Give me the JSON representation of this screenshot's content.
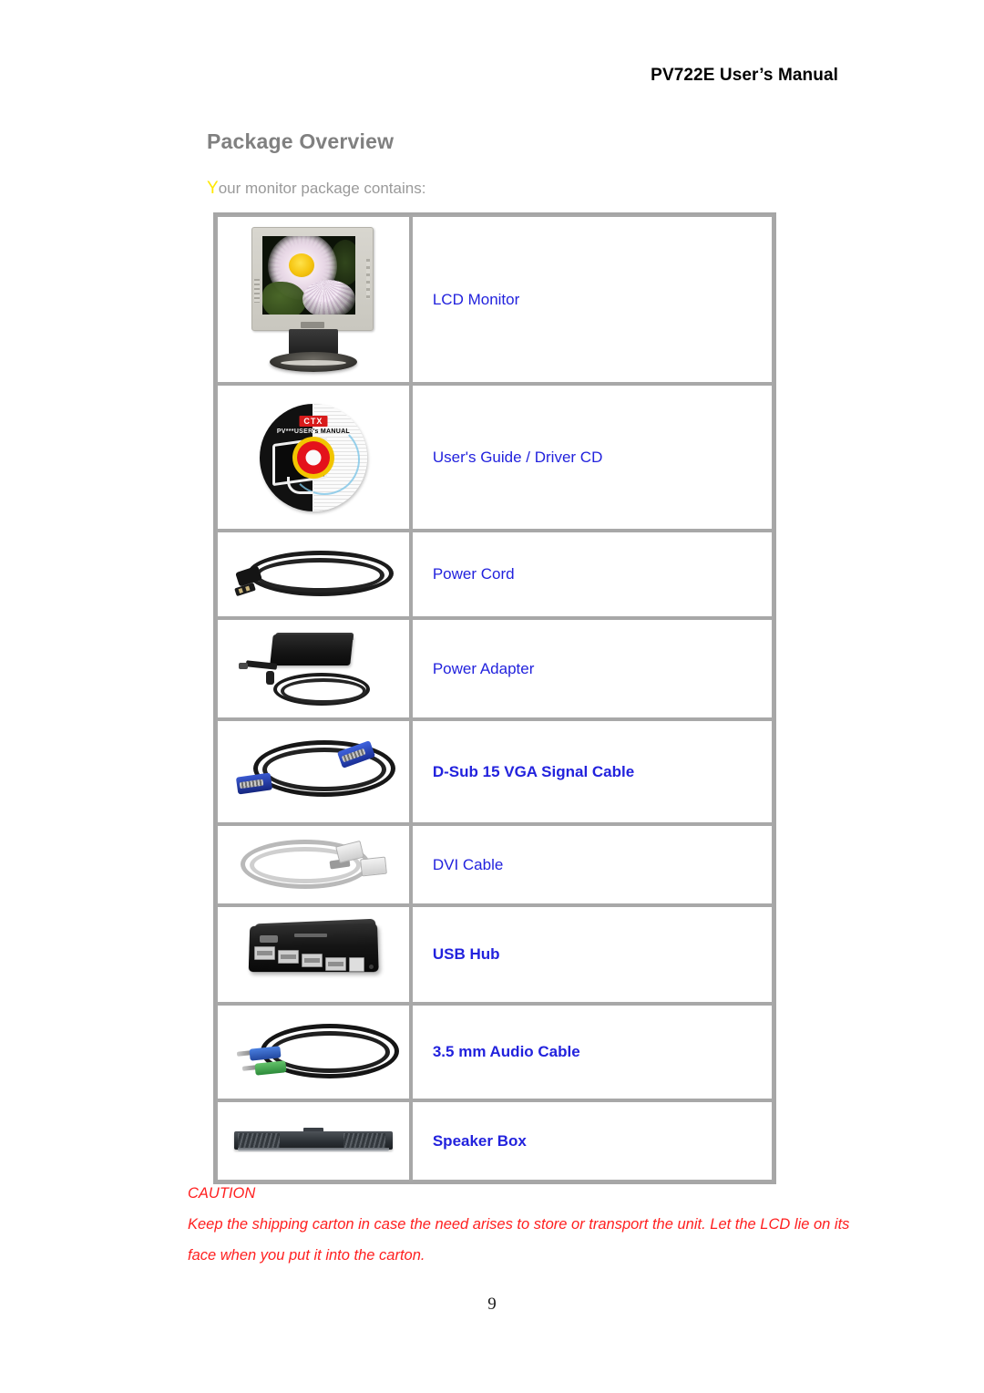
{
  "document": {
    "running_header": "PV722E User’s Manual",
    "section_title": "Package Overview",
    "intro_dropcap": "Y",
    "intro_rest": "our monitor package contains:",
    "page_number": "9"
  },
  "package_table": {
    "rows": [
      {
        "image": "lcd-monitor-photo",
        "label": "LCD Monitor",
        "bold": false
      },
      {
        "image": "driver-cd-photo",
        "label": "User's Guide / Driver CD",
        "bold": false
      },
      {
        "image": "power-cord-photo",
        "label": "Power Cord",
        "bold": false
      },
      {
        "image": "power-adapter-photo",
        "label": "Power Adapter",
        "bold": false
      },
      {
        "image": "vga-cable-photo",
        "label": "D-Sub 15 VGA Signal Cable",
        "bold": true,
        "lead": "D-Sub",
        "rest": " 15 VGA Signal Cable"
      },
      {
        "image": "dvi-cable-photo",
        "label": "DVI Cable",
        "bold": false
      },
      {
        "image": "usb-hub-photo",
        "label": "USB Hub",
        "bold": true
      },
      {
        "image": "audio-cable-photo",
        "label": "3.5 mm Audio Cable",
        "bold": true
      },
      {
        "image": "speaker-box-photo",
        "label": "Speaker Box",
        "bold": true
      }
    ]
  },
  "caution": {
    "title": "CAUTION",
    "body": "Keep the shipping carton in case the need arises to store or transport the unit. Let the LCD lie on its face when you put it into the carton."
  },
  "cd_artwork": {
    "brand": "CTX",
    "title": "PV***USER's MANUAL"
  },
  "colors": {
    "heading_gray": "#808080",
    "body_gray": "#9a9a9a",
    "dropcap_yellow": "#ffe800",
    "label_blue": "#2222dd",
    "caution_red": "#ff2020",
    "table_border": "#a8a8a8"
  }
}
